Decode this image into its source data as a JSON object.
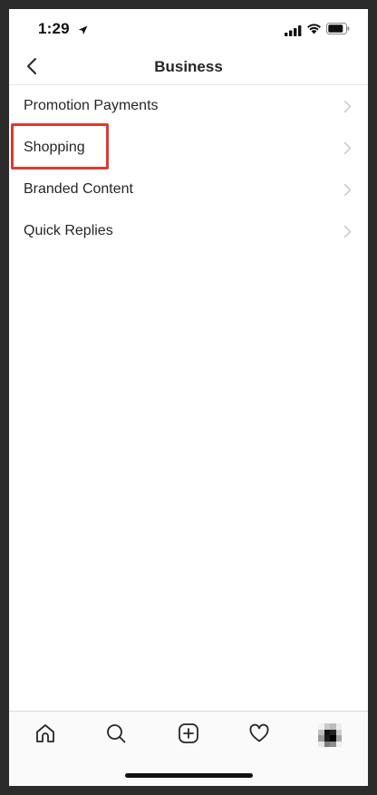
{
  "status_bar": {
    "time": "1:29",
    "icons": [
      "location-arrow-icon",
      "cellular-signal-icon",
      "wifi-icon",
      "battery-icon"
    ]
  },
  "nav": {
    "title": "Business",
    "back_icon": "chevron-left-icon"
  },
  "menu": {
    "items": [
      {
        "label": "Promotion Payments",
        "icon": "chevron-right-icon"
      },
      {
        "label": "Shopping",
        "icon": "chevron-right-icon",
        "highlighted": true
      },
      {
        "label": "Branded Content",
        "icon": "chevron-right-icon"
      },
      {
        "label": "Quick Replies",
        "icon": "chevron-right-icon"
      }
    ]
  },
  "tab_bar": {
    "tabs": [
      {
        "icon": "home-icon"
      },
      {
        "icon": "search-icon"
      },
      {
        "icon": "add-post-icon"
      },
      {
        "icon": "heart-icon"
      },
      {
        "icon": "profile-avatar"
      }
    ]
  },
  "colors": {
    "highlight_border": "#e0392f",
    "text": "#262626",
    "chevron": "#c7c7c7",
    "frame": "#2b2b2b"
  }
}
